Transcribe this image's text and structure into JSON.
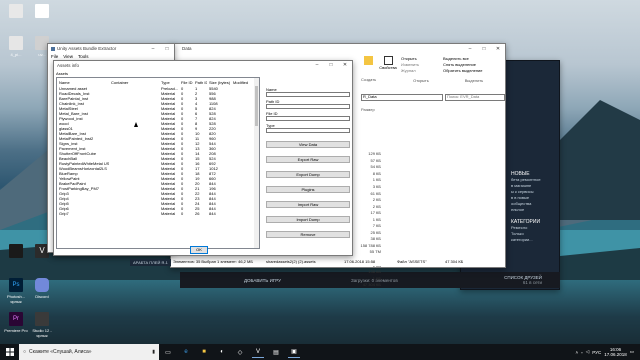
{
  "desktop": {
    "icons": [
      {
        "label": "",
        "color": "#e8e8e8"
      },
      {
        "label": "",
        "color": "#ffffff"
      },
      {
        "label": "4_pi...",
        "color": "#e6e6e6"
      },
      {
        "label": "uv...",
        "color": "#d0d0d0"
      }
    ],
    "bottom_icons": [
      {
        "label": "Photosh... ярлык",
        "color": "#001e36"
      },
      {
        "label": "Discord",
        "color": "#7289da"
      },
      {
        "label": "Premiere Pro",
        "color": "#2a0634"
      },
      {
        "label": "Studio 12 - ярлык",
        "color": "#3a3a3a"
      },
      {
        "label": "",
        "color": "#1a1a1a"
      },
      {
        "label": "VEGAS Pro",
        "color": "#2b2b2b"
      }
    ]
  },
  "uabe": {
    "title": "Unity Assets Bundle Extractor",
    "menu": [
      "File",
      "View",
      "Tools"
    ]
  },
  "assets_info": {
    "title": "Assets info",
    "header": "Assets",
    "columns": [
      "Name",
      "Container",
      "Type",
      "File ID",
      "Path ID",
      "Size (bytes)",
      "Modified"
    ],
    "rows": [
      [
        "Unnamed asset",
        "",
        "Preload...",
        "0",
        "1",
        "5540",
        ""
      ],
      [
        "RoadDecals_Inst",
        "",
        "Material",
        "0",
        "2",
        "556",
        ""
      ],
      [
        "BarePaintal_inst",
        "",
        "Material",
        "0",
        "3",
        "988",
        ""
      ],
      [
        "Chainlink_inst",
        "",
        "Material",
        "0",
        "4",
        "1108",
        ""
      ],
      [
        "MetalSteel",
        "",
        "Material",
        "0",
        "5",
        "824",
        ""
      ],
      [
        "Metal_Bare_inst",
        "",
        "Material",
        "0",
        "6",
        "528",
        ""
      ],
      [
        "Plywood_inst",
        "",
        "Material",
        "0",
        "7",
        "824",
        ""
      ],
      [
        "wood",
        "",
        "Material",
        "0",
        "8",
        "528",
        ""
      ],
      [
        "glass01",
        "",
        "Material",
        "0",
        "9",
        "220",
        ""
      ],
      [
        "MetalBare_Inst",
        "",
        "Material",
        "0",
        "10",
        "820",
        ""
      ],
      [
        "MetalPainted_Inst2",
        "",
        "Material",
        "0",
        "11",
        "960",
        ""
      ],
      [
        "Signs_inst",
        "",
        "Material",
        "0",
        "12",
        "544",
        ""
      ],
      [
        "Pavement_inst",
        "",
        "Material",
        "0",
        "13",
        "360",
        ""
      ],
      [
        "ShutterOffFrontCube",
        "",
        "Material",
        "0",
        "14",
        "208",
        ""
      ],
      [
        "BeachBall",
        "",
        "Material",
        "0",
        "15",
        "524",
        ""
      ],
      [
        "RustyPaintedWhiteMetal US",
        "",
        "Material",
        "0",
        "16",
        "692",
        ""
      ],
      [
        "WoodBeamsHorizontal2LS",
        "",
        "Material",
        "0",
        "17",
        "1012",
        ""
      ],
      [
        "BlueRamp",
        "",
        "Material",
        "0",
        "18",
        "872",
        ""
      ],
      [
        "YellowPaint",
        "",
        "Material",
        "0",
        "19",
        "660",
        ""
      ],
      [
        "BrakePadPaint",
        "",
        "Material",
        "0",
        "20",
        "844",
        ""
      ],
      [
        "FrostParkingBay_PM7",
        "",
        "Material",
        "0",
        "21",
        "196",
        ""
      ],
      [
        "Grip3",
        "",
        "Material",
        "0",
        "22",
        "844",
        ""
      ],
      [
        "Grip4",
        "",
        "Material",
        "0",
        "23",
        "844",
        ""
      ],
      [
        "Grip5",
        "",
        "Material",
        "0",
        "24",
        "844",
        ""
      ],
      [
        "Grip6",
        "",
        "Material",
        "0",
        "25",
        "844",
        ""
      ],
      [
        "Grip7",
        "",
        "Material",
        "0",
        "26",
        "844",
        ""
      ]
    ],
    "fields": [
      {
        "label": "Name",
        "value": ""
      },
      {
        "label": "Path ID",
        "value": ""
      },
      {
        "label": "File ID",
        "value": ""
      },
      {
        "label": "Type",
        "value": ""
      }
    ],
    "buttons": [
      "View Data",
      "Export Raw",
      "Export Dump",
      "Plugins",
      "Import Raw",
      "Import Dump",
      "Remove"
    ],
    "ok_label": "OK"
  },
  "explorer": {
    "title": "Data",
    "ribbon": {
      "open_label": "Открыть",
      "edit_label": "Изменить",
      "history_label": "Журнал",
      "properties_label": "Свойства",
      "select_all": "Выделить все",
      "clear_selection": "Снять выделение",
      "invert_selection": "Обратить выделение",
      "group_open": "Открыть",
      "group_select": "Выделить",
      "group_create": "Создать"
    },
    "breadcrumb": "R_Data",
    "search_placeholder": "Поиск: EVR_Data",
    "size_header": "Размер",
    "sizes": [
      "",
      "",
      "",
      "",
      "",
      "",
      "129 КБ",
      "57 КБ",
      "54 КБ",
      "8 КБ",
      "1 КБ",
      "3 КБ",
      "61 КБ",
      "2 КБ",
      "2 КБ",
      "17 КБ",
      "1 КБ",
      "7 КБ",
      "25 КБ",
      "38 КБ",
      "158 788 КБ",
      "55 ТМ",
      "155 КБ",
      "1 КБ",
      "138 КБ",
      "1 КБ",
      "47 304 КБ"
    ],
    "status_left": "Элементов: 35   Выбран 1 элемент: 46,2 МБ",
    "status_file": "sharedassets2(2) (2).assets",
    "status_date": "17.06.2018 15:58",
    "status_type": "Файл \"ASSETS\"",
    "status_size": "47 304 КБ"
  },
  "steam": {
    "menu_text": "АРАБТА ПЛЕЙ Я-1",
    "add_game": "ДОБАВИТЬ ИГРУ",
    "friends": "СПИСОК ДРУЗЕЙ",
    "online": "61 в сети",
    "side_heading1": "НОВЫЕ",
    "side_items": [
      "бета ремонтное",
      "в магазине",
      "ы к сервисы",
      "в в новые",
      "ообщества",
      "ельное"
    ],
    "side_heading2": "КАТЕГОРИИ",
    "side_items2": [
      "Ремесло",
      "Только",
      "категории..."
    ],
    "downloads": "Загрузки: 0 элементов"
  },
  "taskbar": {
    "search_text": "Скажите «Слушай, Алиса»",
    "time": "16:06",
    "date": "17.06.2018",
    "lang": "РУС"
  }
}
